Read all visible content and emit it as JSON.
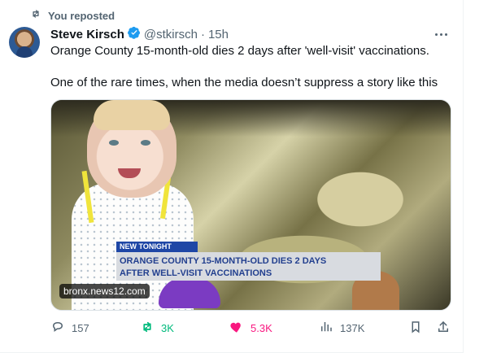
{
  "repost": {
    "label": "You reposted",
    "icon": "repost-icon",
    "color": "#536471"
  },
  "author": {
    "name": "Steve Kirsch",
    "handle": "@stkirsch",
    "separator": "·",
    "time": "15h",
    "verified_icon": "verified-badge-icon",
    "more_icon": "more-options-icon"
  },
  "post": {
    "line1": "Orange County 15-month-old dies 2 days after 'well-visit' vaccinations.",
    "line2": "One of the rare times, when the media doesn’t suppress a story like this"
  },
  "media": {
    "banner_tag": "NEW TONIGHT",
    "headline_line1": "ORANGE COUNTY 15-MONTH-OLD DIES 2 DAYS",
    "headline_line2": "AFTER WELL-VISIT VACCINATIONS",
    "source": "bronx.news12.com",
    "accent": "#1f47a6"
  },
  "actions": {
    "reply": {
      "count": "157",
      "icon": "reply-icon"
    },
    "repost": {
      "count": "3K",
      "icon": "repost-icon",
      "color": "#00ba7c"
    },
    "like": {
      "count": "5.3K",
      "icon": "like-heart-icon",
      "color": "#f91880"
    },
    "views": {
      "count": "137K",
      "icon": "views-chart-icon"
    },
    "bookmark": {
      "icon": "bookmark-icon"
    },
    "share": {
      "icon": "share-icon"
    }
  }
}
